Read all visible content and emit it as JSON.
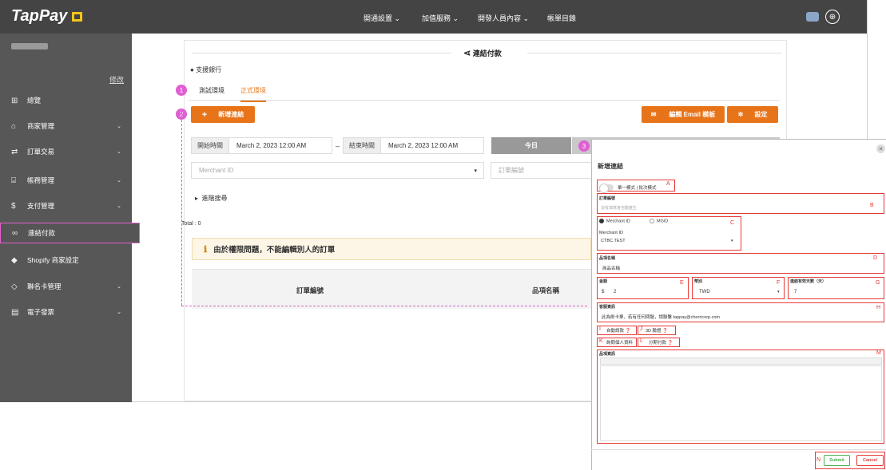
{
  "brand": {
    "name": "TapPay"
  },
  "topnav": [
    {
      "label": "開通設置 ⌄"
    },
    {
      "label": "加值服務 ⌄"
    },
    {
      "label": "開發人員內容 ⌄"
    },
    {
      "label": "帳單目錄"
    }
  ],
  "sidebar": {
    "edit_label": "修改",
    "items": [
      {
        "label": "總覽",
        "icon": "dashboard-icon",
        "glyph": "⊞",
        "arrow": ""
      },
      {
        "label": "商家管理",
        "icon": "store-icon",
        "glyph": "⌂",
        "arrow": "⌄"
      },
      {
        "label": "訂單交易",
        "icon": "order-icon",
        "glyph": "⇄",
        "arrow": "⌄"
      },
      {
        "label": "帳務管理",
        "icon": "bank-icon",
        "glyph": "⌸",
        "arrow": "⌄"
      },
      {
        "label": "支付管理",
        "icon": "payment-icon",
        "glyph": "$",
        "arrow": "⌄"
      },
      {
        "label": "連結付款",
        "icon": "link-icon",
        "glyph": "∞",
        "arrow": ""
      },
      {
        "label": "Shopify 商家設定",
        "icon": "shopify-icon",
        "glyph": "◆",
        "arrow": ""
      },
      {
        "label": "聯名卡管理",
        "icon": "card-icon",
        "glyph": "◇",
        "arrow": "⌄"
      },
      {
        "label": "電子發票",
        "icon": "invoice-icon",
        "glyph": "▤",
        "arrow": "⌄"
      }
    ]
  },
  "page": {
    "title": "連結付款",
    "support_bank": "支援銀行",
    "tabs": [
      "測試環境",
      "正式環境"
    ],
    "new_link_button": "新增連結",
    "email_template_button": "編輯 Email 模板",
    "settings_button": "設定",
    "start_label": "開始時間",
    "start_value": "March 2, 2023 12:00 AM",
    "dash": "–",
    "end_label": "結束時間",
    "end_value": "March 2, 2023 12:00 AM",
    "today_button": "今日",
    "merchant_placeholder": "Merchant ID",
    "order_placeholder": "訂單編號",
    "advanced_search": "進階搜尋",
    "total": "Total : 0",
    "warning": "由於權限問題，不能編輯別人的訂單",
    "col_order": "訂單編號",
    "col_item": "品項名稱"
  },
  "badges": [
    "1",
    "2",
    "3"
  ],
  "modal": {
    "title": "新增連結",
    "mode_text": "單一模式 | 批次模式",
    "order_no_label": "訂單編號",
    "order_no_placeholder": "沒有填寫會自動產生",
    "radio_merchant": "Merchant ID",
    "radio_mgid": "MGID",
    "merchant_label": "Merchant ID",
    "merchant_value": "CTBC.TEST",
    "item_name_label": "品項名稱",
    "item_name_value": "商品名稱",
    "amount_label": "金額",
    "amount_prefix": "$",
    "amount_value": "2",
    "currency_label": "幣別",
    "currency_value": "TWD",
    "valid_days_label": "連結有效天數（天）",
    "valid_days_value": "7",
    "cs_label": "客服資訊",
    "cs_value": "此為刷卡單，若有任何問題，請聯繫 tappay@cherricorp.com",
    "auto_request": "自動請款",
    "verify_3d": "3D 驗證",
    "ask_personal": "詢問個人資料",
    "installment": "分期付款",
    "item_info_label": "品項資訊",
    "submit": "Submit",
    "cancel": "Cancel",
    "markers": [
      "A",
      "B",
      "C",
      "D",
      "E",
      "F",
      "G",
      "H",
      "I",
      "J",
      "K",
      "L",
      "M",
      "N"
    ]
  },
  "colors": {
    "accent": "#e8741a",
    "annotation": "#e53935",
    "badge": "#e05fd2",
    "sidebar": "#575757",
    "topbar": "#444444"
  }
}
